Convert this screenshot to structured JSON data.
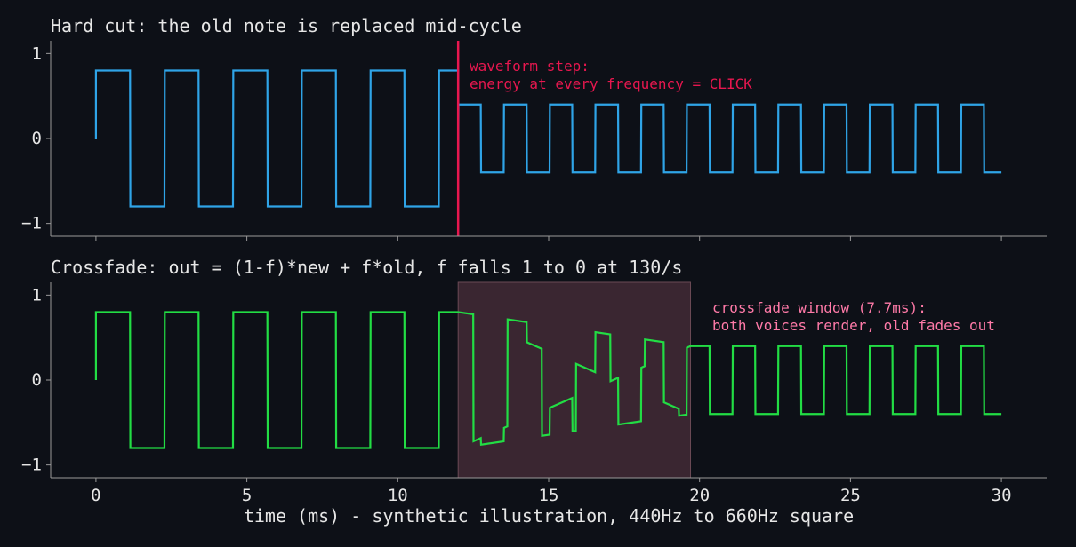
{
  "chart_data": [
    {
      "type": "line",
      "title": "Hard cut: the old note is replaced mid-cycle",
      "xlim": [
        -1.5,
        31.5
      ],
      "ylim": [
        -1.15,
        1.15
      ],
      "yticks": [
        1,
        0,
        -1
      ],
      "ytick_labels": [
        "1",
        "0",
        "−1"
      ],
      "xticks": [
        0,
        5,
        10,
        15,
        20,
        25,
        30
      ],
      "series": [
        {
          "color": "#2fa4e7",
          "segments": [
            {
              "start": 0,
              "end": 12,
              "freq_hz": 440,
              "amplitude": 0.8
            },
            {
              "start": 12,
              "end": 30,
              "freq_hz": 660,
              "amplitude": 0.4,
              "start_value": -0.4
            }
          ]
        }
      ],
      "marker_line": {
        "x": 12,
        "color": "#e8174f"
      },
      "annotation": {
        "lines": [
          "waveform step:",
          "energy at every frequency = CLICK"
        ],
        "color": "#e8174f"
      }
    },
    {
      "type": "line",
      "title": "Crossfade: out = (1-f)*new + f*old, f falls 1 to 0 at 130/s",
      "xlim": [
        -1.5,
        31.5
      ],
      "ylim": [
        -1.15,
        1.15
      ],
      "yticks": [
        1,
        0,
        -1
      ],
      "ytick_labels": [
        "1",
        "0",
        "−1"
      ],
      "xticks": [
        0,
        5,
        10,
        15,
        20,
        25,
        30
      ],
      "xtick_labels": [
        "0",
        "5",
        "10",
        "15",
        "20",
        "25",
        "30"
      ],
      "xlabel": "time (ms) - synthetic illustration, 440Hz to 660Hz square",
      "series": [
        {
          "color": "#22dd44",
          "crossfade": {
            "start": 12,
            "end": 19.7,
            "old_amplitude": 0.8,
            "new_amplitude": 0.4,
            "old_freq_hz": 440,
            "new_freq_hz": 660
          }
        }
      ],
      "shaded_window": {
        "start": 12,
        "end": 19.7,
        "color": "#3a2631",
        "edge": "#6b4a55"
      },
      "annotation": {
        "lines": [
          "crossfade window (7.7ms):",
          "both voices render, old fades out"
        ],
        "color": "#ff7aa8"
      }
    }
  ]
}
